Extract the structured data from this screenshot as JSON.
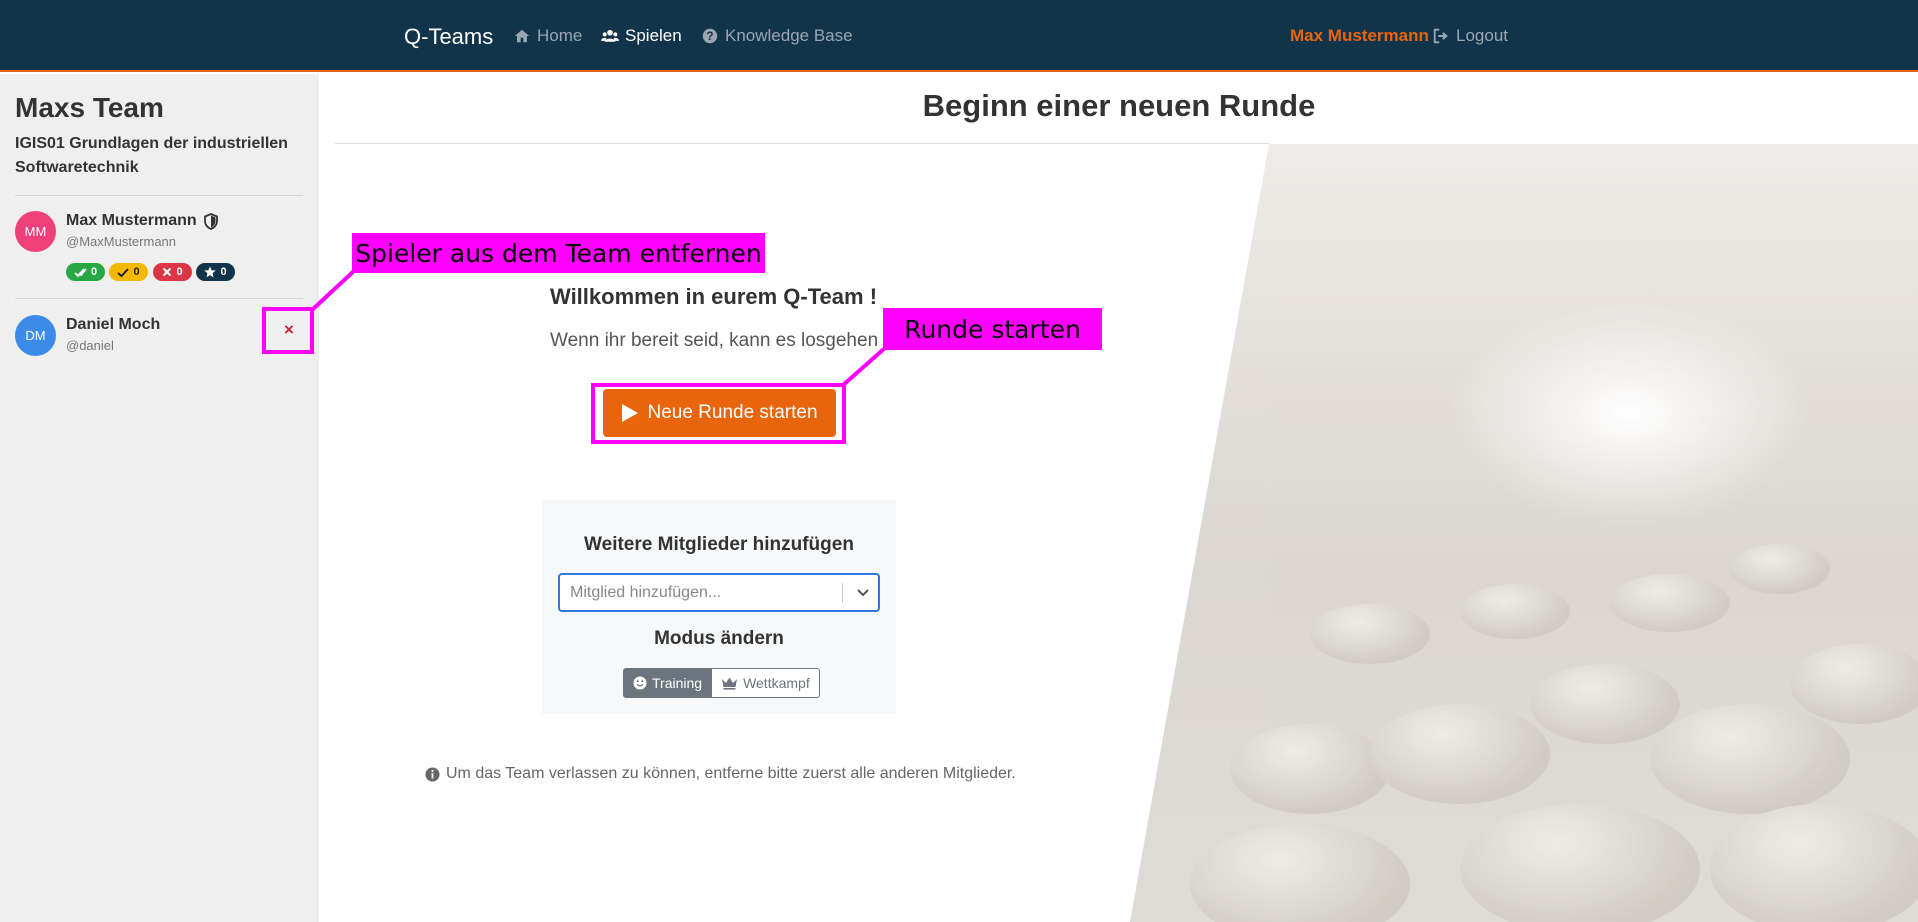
{
  "navbar": {
    "brand": "Q-Teams",
    "links": [
      {
        "label": "Home",
        "icon": "home-icon"
      },
      {
        "label": "Spielen",
        "icon": "users-icon"
      },
      {
        "label": "Knowledge Base",
        "icon": "question-circle-icon"
      }
    ],
    "user_name": "Max Mustermann",
    "logout_label": "Logout",
    "colors": {
      "background": "#12344a",
      "accent": "#e8650e"
    }
  },
  "sidebar": {
    "team_name": "Maxs Team",
    "course": "IGIS01 Grundlagen der industriellen Softwaretechnik",
    "members": [
      {
        "initials": "MM",
        "name": "Max Mustermann",
        "handle": "@MaxMustermann",
        "avatar_color": "#f0407a",
        "role_icon": "shield-icon",
        "badges": [
          {
            "icon": "double-check-icon",
            "value": "0",
            "color": "#28a745"
          },
          {
            "icon": "check-icon",
            "value": "0",
            "color": "#f5b800"
          },
          {
            "icon": "x-icon",
            "value": "0",
            "color": "#dc3545"
          },
          {
            "icon": "star-icon",
            "value": "0",
            "color": "#12344a"
          }
        ]
      },
      {
        "initials": "DM",
        "name": "Daniel Moch",
        "handle": "@daniel",
        "avatar_color": "#3d8be8",
        "remove_label": "×"
      }
    ]
  },
  "main": {
    "title": "Beginn einer neuen Runde",
    "welcome_title": "Willkommen in eurem Q-Team !",
    "welcome_text": "Wenn ihr bereit seid, kann es losgehen",
    "start_button_label": "Neue Runde starten",
    "add_members_heading": "Weitere Mitglieder hinzufügen",
    "add_member_placeholder": "Mitglied hinzufügen...",
    "mode_heading": "Modus ändern",
    "modes": [
      {
        "label": "Training",
        "icon": "smile-icon",
        "active": true
      },
      {
        "label": "Wettkampf",
        "icon": "crown-icon",
        "active": false
      }
    ],
    "leave_note": "Um das Team verlassen zu können, entferne bitte zuerst alle anderen Mitglieder."
  },
  "annotations": {
    "remove_player_label": "Spieler aus dem Team entfernen",
    "start_round_label": "Runde starten",
    "color": "#ff00ff"
  }
}
